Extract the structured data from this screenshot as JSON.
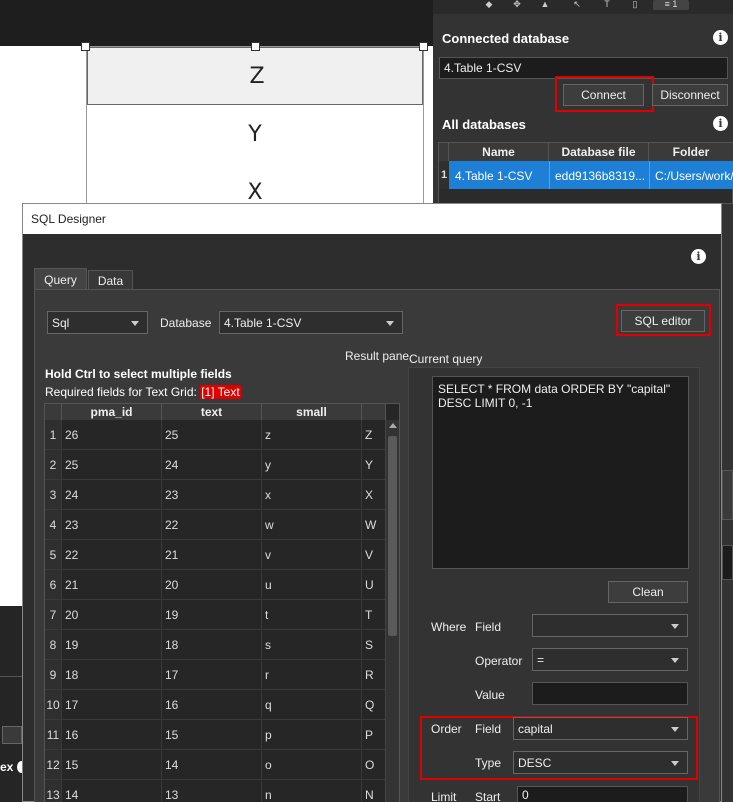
{
  "canvas": {
    "text_rows": [
      "Z",
      "Y",
      "X"
    ]
  },
  "right_panel": {
    "connected_db_title": "Connected database",
    "connected_db_value": "4.Table 1-CSV",
    "connect_label": "Connect",
    "disconnect_label": "Disconnect",
    "all_db_title": "All databases",
    "info_glyph": "i",
    "columns": [
      "Name",
      "Database file",
      "Folder"
    ],
    "rows": [
      {
        "num": "1",
        "name": "4.Table 1-CSV",
        "file": "edd9136b8319...",
        "folder": "C:/Users/work/"
      }
    ],
    "toolbar_count": "1"
  },
  "dialog": {
    "title": "SQL Designer",
    "info_glyph": "i",
    "tabs": [
      "Query",
      "Data"
    ],
    "mode_value": "Sql",
    "database_label": "Database",
    "database_value": "4.Table 1-CSV",
    "sql_editor_label": "SQL editor",
    "result_pane_label": "Result pane",
    "hint": "Hold Ctrl to select multiple fields",
    "required_prefix": "Required fields for Text Grid:",
    "required_field": "[1] Text",
    "grid_columns": [
      "pma_id",
      "text",
      "small"
    ],
    "grid_rows": [
      [
        "1",
        "26",
        "25",
        "z",
        "Z"
      ],
      [
        "2",
        "25",
        "24",
        "y",
        "Y"
      ],
      [
        "3",
        "24",
        "23",
        "x",
        "X"
      ],
      [
        "4",
        "23",
        "22",
        "w",
        "W"
      ],
      [
        "5",
        "22",
        "21",
        "v",
        "V"
      ],
      [
        "6",
        "21",
        "20",
        "u",
        "U"
      ],
      [
        "7",
        "20",
        "19",
        "t",
        "T"
      ],
      [
        "8",
        "19",
        "18",
        "s",
        "S"
      ],
      [
        "9",
        "18",
        "17",
        "r",
        "R"
      ],
      [
        "10",
        "17",
        "16",
        "q",
        "Q"
      ],
      [
        "11",
        "16",
        "15",
        "p",
        "P"
      ],
      [
        "12",
        "15",
        "14",
        "o",
        "O"
      ],
      [
        "13",
        "14",
        "13",
        "n",
        "N"
      ]
    ],
    "current_query_label": "Current query",
    "query_text": "SELECT * FROM data ORDER BY \"capital\" DESC LIMIT 0, -1",
    "clean_label": "Clean",
    "where_label": "Where",
    "field_label": "Field",
    "where_field_value": "",
    "operator_label": "Operator",
    "operator_value": "=",
    "value_label": "Value",
    "value_value": "",
    "order_label": "Order",
    "order_field_value": "capital",
    "type_label": "Type",
    "order_type_value": "DESC",
    "limit_label": "Limit",
    "start_label": "Start",
    "start_value": "0"
  },
  "left_partial": {
    "text": "ex"
  },
  "colors": {
    "highlight_red": "#e00000",
    "selection_blue": "#1e7fd6"
  }
}
